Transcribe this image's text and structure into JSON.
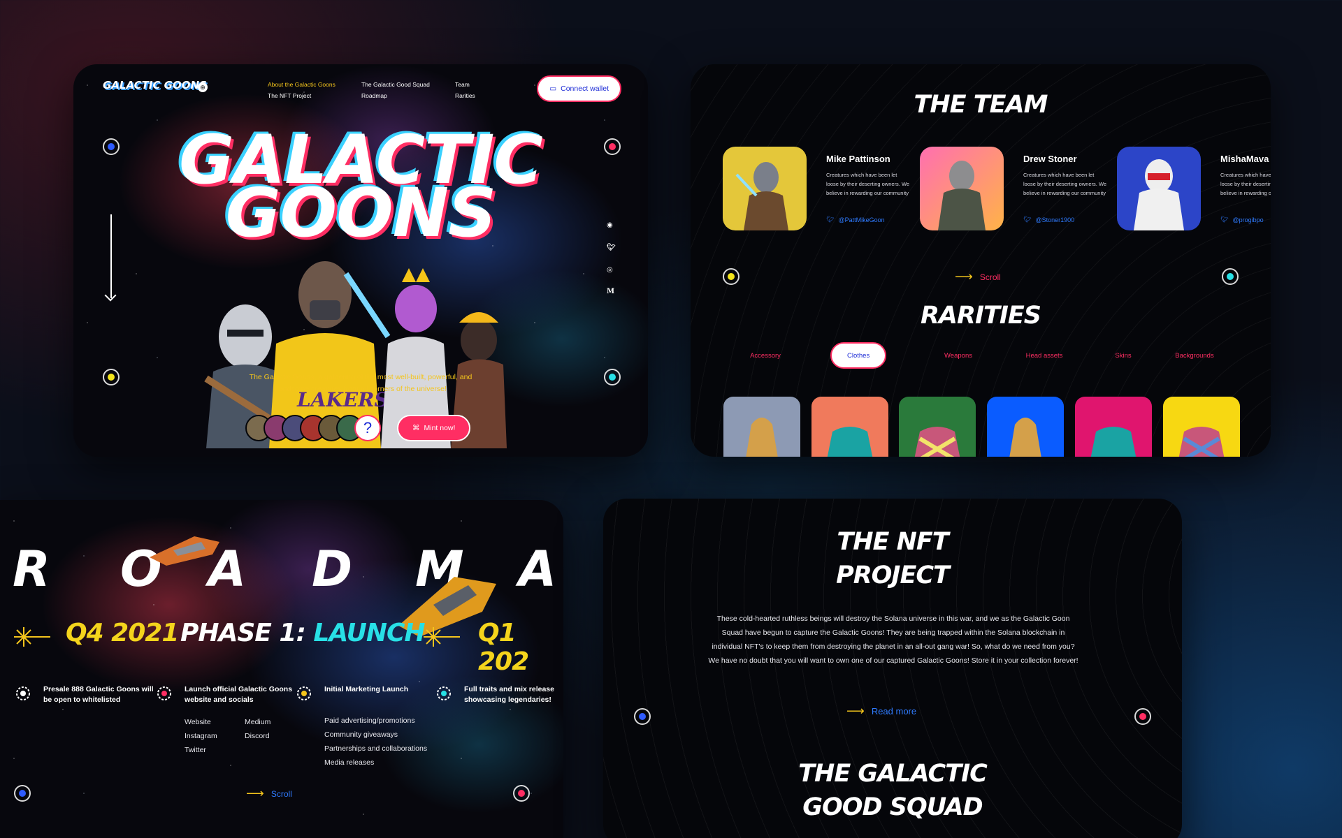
{
  "hero": {
    "logo": "GALACTIC GOONS",
    "lang": "⊕",
    "nav": [
      {
        "label": "About the Galactic Goons",
        "active": true
      },
      {
        "label": "The Galactic Good Squad",
        "active": false
      },
      {
        "label": "Team",
        "active": false
      },
      {
        "label": "The NFT Project",
        "active": false
      },
      {
        "label": "Roadmap",
        "active": false
      },
      {
        "label": "Rarities",
        "active": false
      }
    ],
    "connect_label": "Connect wallet",
    "title_line1": "GALACTIC",
    "title_line2": "GOONS",
    "tagline_1": "The Galactic Goons, a gathering of the most well-built, powerful, and",
    "tagline_2": "handsome creatures from all corners of the universe!",
    "social": [
      "discord-icon",
      "twitter-icon",
      "instagram-icon",
      "medium-icon"
    ],
    "medium_letter": "M",
    "question_mark": "?",
    "mint_label": "Mint now!"
  },
  "team": {
    "title": "THE TEAM",
    "members": [
      {
        "name": "Mike Pattinson",
        "desc": "Creatures which have been let loose by their deserting owners. We believe in rewarding our community",
        "handle": "@PattMikeGoon"
      },
      {
        "name": "Drew Stoner",
        "desc": "Creatures which have been let loose by their deserting owners. We believe in rewarding our community",
        "handle": "@Stoner1900"
      },
      {
        "name": "MishaMava",
        "desc": "Creatures which have been let loose by their deserting owners. We believe in rewarding our community",
        "handle": "@progibpo"
      }
    ],
    "scroll_label": "Scroll"
  },
  "rarities": {
    "title": "RARITIES",
    "tabs": [
      "Accessory",
      "Clothes",
      "Weapons",
      "Head assets",
      "Skins",
      "Backgrounds"
    ],
    "selected_tab": "Clothes",
    "swatches": [
      "#8d9ab4",
      "#f07a5c",
      "#2a7a3b",
      "#0a5cff",
      "#e0156e",
      "#f7d812"
    ]
  },
  "roadmap": {
    "letters": [
      "R",
      "O",
      "A",
      "D",
      "M",
      "A"
    ],
    "q4": "Q4 2021",
    "phase_prefix": "PHASE 1:",
    "phase_highlight": "LAUNCH",
    "q1": "Q1 202",
    "steps": [
      {
        "title": "Presale 888 Galactic Goons will be open to whitelisted"
      },
      {
        "title": "Launch official Galactic Goons website and socials"
      },
      {
        "title": "Initial Marketing Launch"
      },
      {
        "title": "Full traits and mix release showcasing legendaries!"
      }
    ],
    "socials_left": [
      "Website",
      "Instagram",
      "Twitter"
    ],
    "socials_right": [
      "Medium",
      "Discord"
    ],
    "marketing": [
      "Paid advertising/promotions",
      "Community giveaways",
      "Partnerships and collaborations",
      "Media releases"
    ],
    "scroll_label": "Scroll"
  },
  "nft": {
    "title_1": "THE NFT",
    "title_2": "PROJECT",
    "paragraph": "These cold-hearted ruthless beings will destroy the Solana universe in this war, and we as the Galactic Goon Squad have begun to capture the Galactic Goons! They are being trapped within the Solana blockchain in individual NFT's to keep them from destroying the planet in an all-out gang war! So, what do we need from you? We have no doubt that you will want to own one of our captured Galactic Goons! Store it in your collection forever!",
    "read_more": "Read more",
    "squad_1": "THE GALACTIC",
    "squad_2": "GOOD SQUAD"
  },
  "colors": {
    "accent_pink": "#ff2e63",
    "accent_yellow": "#f4c51c",
    "accent_blue": "#2f7bff",
    "accent_cyan": "#28e0e6"
  }
}
